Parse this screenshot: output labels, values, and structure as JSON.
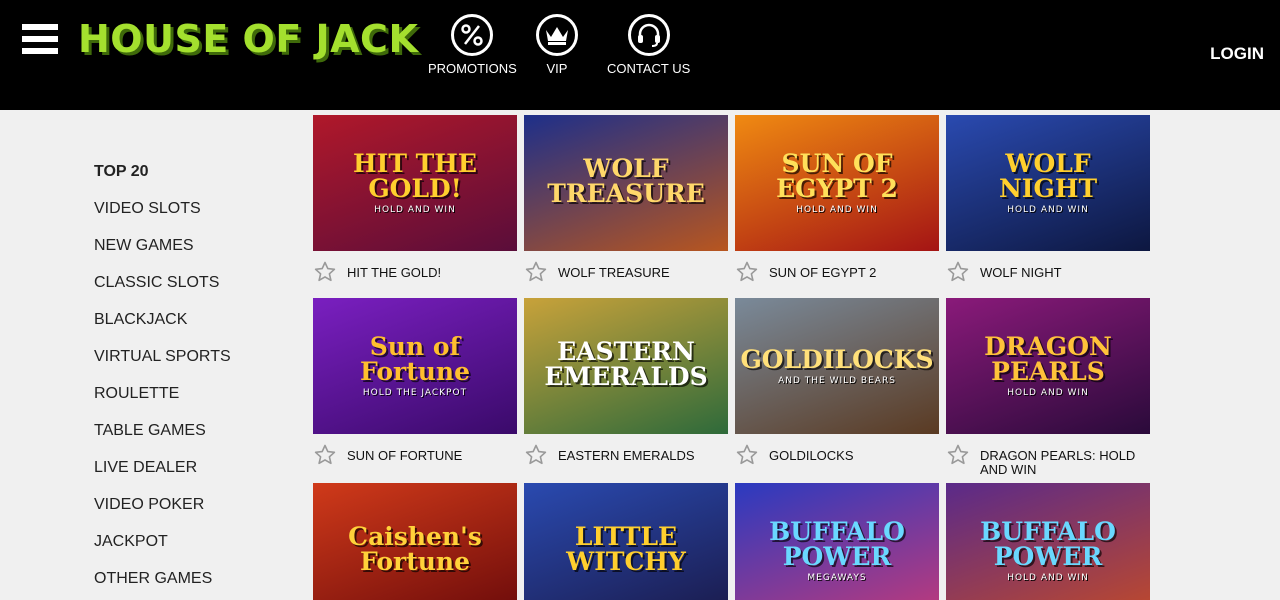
{
  "header": {
    "logo_text": "HOUSE OF JACK",
    "nav": [
      {
        "label": "PROMOTIONS",
        "icon": "percent-icon"
      },
      {
        "label": "VIP",
        "icon": "crown-icon"
      },
      {
        "label": "CONTACT US",
        "icon": "headset-icon"
      }
    ],
    "login_label": "LOGIN"
  },
  "sidebar": {
    "items": [
      {
        "label": "TOP 20",
        "active": true
      },
      {
        "label": "VIDEO SLOTS"
      },
      {
        "label": "NEW GAMES"
      },
      {
        "label": "CLASSIC SLOTS"
      },
      {
        "label": "BLACKJACK"
      },
      {
        "label": "VIRTUAL SPORTS"
      },
      {
        "label": "ROULETTE"
      },
      {
        "label": "TABLE GAMES"
      },
      {
        "label": "LIVE DEALER"
      },
      {
        "label": "VIDEO POKER"
      },
      {
        "label": "JACKPOT"
      },
      {
        "label": "OTHER GAMES"
      }
    ]
  },
  "games": [
    {
      "title": "HIT THE GOLD!",
      "art": "HIT THE GOLD!",
      "art_sub": "HOLD AND WIN",
      "colors": [
        "#b0182a",
        "#5a0d3a"
      ],
      "art_color": "#ffcf2e"
    },
    {
      "title": "WOLF TREASURE",
      "art": "WOLF TREASURE",
      "art_sub": "",
      "colors": [
        "#1d2f8a",
        "#b8561f"
      ],
      "art_color": "#ffd86a"
    },
    {
      "title": "SUN OF EGYPT 2",
      "art": "SUN OF EGYPT 2",
      "art_sub": "HOLD AND WIN",
      "colors": [
        "#f08a12",
        "#a41414"
      ],
      "art_color": "#ffe05a"
    },
    {
      "title": "WOLF NIGHT",
      "art": "WOLF NIGHT",
      "art_sub": "HOLD AND WIN",
      "colors": [
        "#2a4ab0",
        "#0d1740"
      ],
      "art_color": "#ffcf2e"
    },
    {
      "title": "SUN OF FORTUNE",
      "art": "Sun of Fortune",
      "art_sub": "HOLD THE JACKPOT",
      "colors": [
        "#7a1fc0",
        "#3a0a6a"
      ],
      "art_color": "#ffbf2e"
    },
    {
      "title": "EASTERN EMERALDS",
      "art": "EASTERN EMERALDS",
      "art_sub": "",
      "colors": [
        "#c8a23a",
        "#2e6a3a"
      ],
      "art_color": "#ffffff"
    },
    {
      "title": "GOLDILOCKS",
      "art": "GOLDILOCKS",
      "art_sub": "AND THE WILD BEARS",
      "colors": [
        "#7a8a9a",
        "#5a3a22"
      ],
      "art_color": "#ffe07a"
    },
    {
      "title": "DRAGON PEARLS: HOLD AND WIN",
      "art": "DRAGON PEARLS",
      "art_sub": "HOLD AND WIN",
      "colors": [
        "#8a1a7a",
        "#2a0a3a"
      ],
      "art_color": "#ffc23a"
    },
    {
      "title": "",
      "art": "Caishen's Fortune",
      "art_sub": "",
      "colors": [
        "#d03a1a",
        "#6a0a0a"
      ],
      "art_color": "#ffd23a"
    },
    {
      "title": "",
      "art": "LITTLE WITCHY",
      "art_sub": "",
      "colors": [
        "#2a4ab0",
        "#1a1a4a"
      ],
      "art_color": "#ffcf2e"
    },
    {
      "title": "",
      "art": "BUFFALO POWER",
      "art_sub": "MEGAWAYS",
      "colors": [
        "#2a3ac0",
        "#c03a7a"
      ],
      "art_color": "#6ad8ff"
    },
    {
      "title": "",
      "art": "BUFFALO POWER",
      "art_sub": "HOLD AND WIN",
      "colors": [
        "#5a2a8a",
        "#c04a2a"
      ],
      "art_color": "#6ad8ff"
    }
  ]
}
